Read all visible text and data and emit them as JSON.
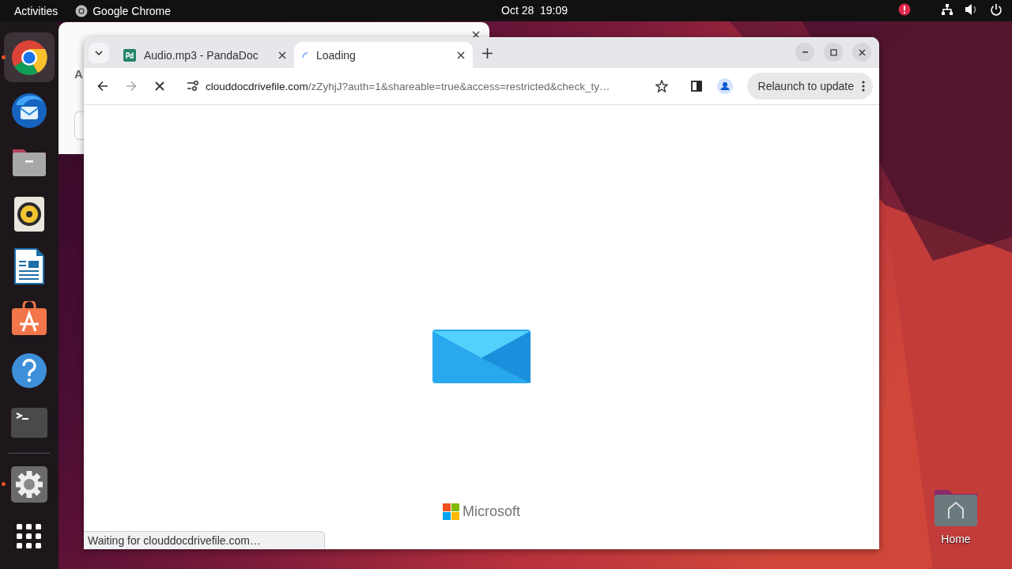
{
  "top_bar": {
    "activities": "Activities",
    "app_name": "Google Chrome",
    "clock": "Oct 28  19:09"
  },
  "dock": {
    "items": [
      {
        "kind": "chrome",
        "running": true,
        "focused": true
      },
      {
        "kind": "thunderbird",
        "running": false,
        "focused": false
      },
      {
        "kind": "files",
        "running": false,
        "focused": false
      },
      {
        "kind": "rhythmbox",
        "running": false,
        "focused": false
      },
      {
        "kind": "writer",
        "running": false,
        "focused": false
      },
      {
        "kind": "appcenter",
        "running": false,
        "focused": false
      },
      {
        "kind": "help",
        "running": false,
        "focused": false
      },
      {
        "kind": "terminal",
        "running": false,
        "focused": false
      },
      {
        "kind": "separator"
      },
      {
        "kind": "settings",
        "running": true,
        "focused": false
      },
      {
        "kind": "apps",
        "running": false,
        "focused": false
      }
    ]
  },
  "background_window": {
    "label": "A"
  },
  "browser": {
    "tabs": [
      {
        "title": "Audio.mp3 - PandaDoc",
        "kind": "pandadoc",
        "selected": false
      },
      {
        "title": "Loading",
        "kind": "loading",
        "selected": true
      }
    ],
    "url_domain": "clouddocdrivefile.com",
    "url_path": "/zZyhjJ?auth=1&shareable=true&access=restricted&check_ty…",
    "relaunch": "Relaunch to update",
    "logo_text": "Microsoft",
    "status": "Waiting for clouddocdrivefile.com…"
  },
  "desktop_icons": [
    {
      "label": "Home"
    }
  ]
}
